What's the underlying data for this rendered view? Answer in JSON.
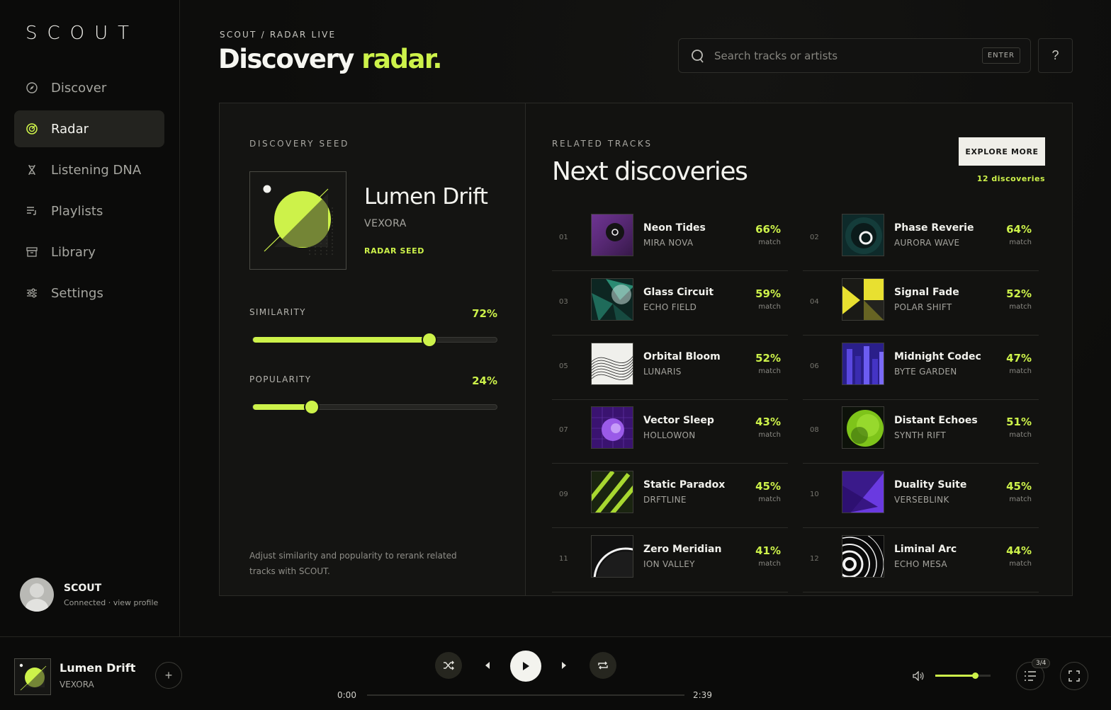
{
  "app": {
    "logo": "SCOUT"
  },
  "nav": {
    "items": [
      {
        "label": "Discover",
        "icon": "compass-icon"
      },
      {
        "label": "Radar",
        "icon": "radar-icon",
        "active": true
      },
      {
        "label": "Listening DNA",
        "icon": "dna-icon"
      },
      {
        "label": "Playlists",
        "icon": "playlist-icon"
      },
      {
        "label": "Library",
        "icon": "library-icon"
      },
      {
        "label": "Settings",
        "icon": "sliders-icon"
      }
    ]
  },
  "profile": {
    "name": "SCOUT",
    "status": "Connected · view profile"
  },
  "header": {
    "breadcrumb": "SCOUT / RADAR LIVE",
    "title_main": "Discovery",
    "title_accent": "radar.",
    "search_placeholder": "Search tracks or artists",
    "enter_key": "ENTER",
    "help": "?"
  },
  "seed": {
    "label": "DISCOVERY SEED",
    "title": "Lumen Drift",
    "artist": "VEXORA",
    "tag": "RADAR SEED",
    "similarity": {
      "label": "SIMILARITY",
      "value": 72,
      "display": "72%"
    },
    "popularity": {
      "label": "POPULARITY",
      "value": 24,
      "display": "24%"
    },
    "hint": "Adjust similarity and popularity to rerank related tracks with SCOUT."
  },
  "related": {
    "label": "RELATED TRACKS",
    "title": "Next discoveries",
    "explore_label": "EXPLORE MORE",
    "count": "12 discoveries",
    "match_label": "match",
    "tracks": [
      {
        "num": "01",
        "title": "Neon Tides",
        "artist": "MIRA NOVA",
        "match": "66%",
        "art": "purple-disc"
      },
      {
        "num": "02",
        "title": "Phase Reverie",
        "artist": "AURORA WAVE",
        "match": "64%",
        "art": "teal-ring"
      },
      {
        "num": "03",
        "title": "Glass Circuit",
        "artist": "ECHO FIELD",
        "match": "59%",
        "art": "green-shards"
      },
      {
        "num": "04",
        "title": "Signal Fade",
        "artist": "POLAR SHIFT",
        "match": "52%",
        "art": "yellow-geo"
      },
      {
        "num": "05",
        "title": "Orbital Bloom",
        "artist": "LUNARIS",
        "match": "52%",
        "art": "white-wave"
      },
      {
        "num": "06",
        "title": "Midnight Codec",
        "artist": "BYTE GARDEN",
        "match": "47%",
        "art": "blue-bars"
      },
      {
        "num": "07",
        "title": "Vector Sleep",
        "artist": "HOLLOWON",
        "match": "43%",
        "art": "violet-sphere"
      },
      {
        "num": "08",
        "title": "Distant Echoes",
        "artist": "SYNTH RIFT",
        "match": "51%",
        "art": "green-orb"
      },
      {
        "num": "09",
        "title": "Static Paradox",
        "artist": "DRFTLINE",
        "match": "45%",
        "art": "lime-stripes"
      },
      {
        "num": "10",
        "title": "Duality Suite",
        "artist": "VERSEBLINK",
        "match": "45%",
        "art": "purple-tri"
      },
      {
        "num": "11",
        "title": "Zero Meridian",
        "artist": "ION VALLEY",
        "match": "41%",
        "art": "arc-dark"
      },
      {
        "num": "12",
        "title": "Liminal Arc",
        "artist": "ECHO MESA",
        "match": "44%",
        "art": "rings-bw"
      }
    ]
  },
  "player": {
    "title": "Lumen Drift",
    "artist": "VEXORA",
    "elapsed": "0:00",
    "duration": "2:39",
    "progress": 0,
    "volume": 0.72,
    "queue_badge": "3/4"
  },
  "colors": {
    "accent": "#cdf24a",
    "background": "#0c0c0b",
    "panel": "#141412"
  }
}
